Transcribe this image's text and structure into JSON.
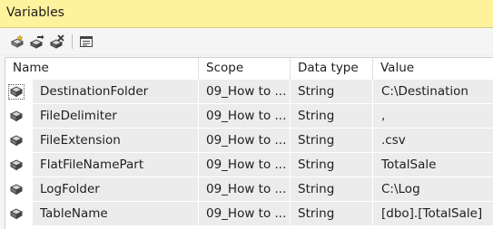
{
  "window": {
    "title": "Variables"
  },
  "toolbar": {
    "buttons": [
      {
        "icon": "add-variable-icon"
      },
      {
        "icon": "move-variable-icon"
      },
      {
        "icon": "delete-variable-icon"
      },
      {
        "icon": "grid-options-icon"
      }
    ]
  },
  "grid": {
    "columns": {
      "name": "Name",
      "scope": "Scope",
      "data_type": "Data type",
      "value": "Value"
    },
    "rows": [
      {
        "name": "DestinationFolder",
        "scope": "09_How to ...",
        "data_type": "String",
        "value": "C:\\Destination",
        "selected": true
      },
      {
        "name": "FileDelimiter",
        "scope": "09_How to ...",
        "data_type": "String",
        "value": ","
      },
      {
        "name": "FileExtension",
        "scope": "09_How to ...",
        "data_type": "String",
        "value": ".csv"
      },
      {
        "name": "FlatFileNamePart",
        "scope": "09_How to ...",
        "data_type": "String",
        "value": "TotalSale"
      },
      {
        "name": "LogFolder",
        "scope": "09_How to ...",
        "data_type": "String",
        "value": "C:\\Log"
      },
      {
        "name": "TableName",
        "scope": "09_How to ...",
        "data_type": "String",
        "value": "[dbo].[TotalSale]"
      }
    ]
  },
  "colors": {
    "title_bar": "#fff29d",
    "cell_bg": "#ececec",
    "header_bg": "#ffffff"
  }
}
